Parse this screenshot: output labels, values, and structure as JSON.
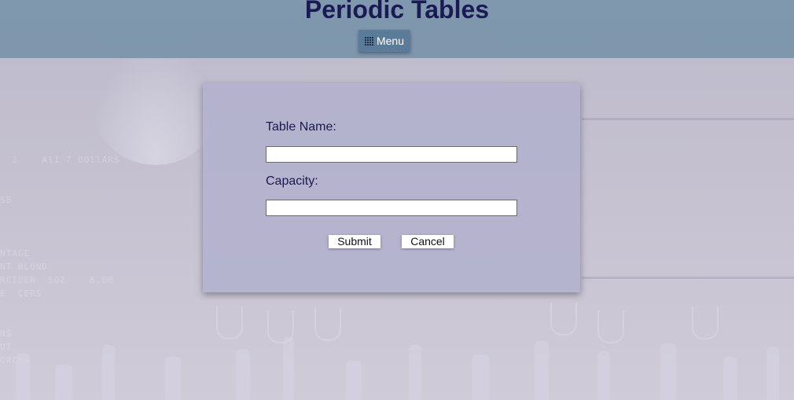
{
  "header": {
    "title": "Periodic Tables",
    "menu_label": "Menu",
    "menu_icon": "grid-icon"
  },
  "form": {
    "table_name_label": "Table Name:",
    "table_name_value": "",
    "capacity_label": "Capacity:",
    "capacity_value": "",
    "submit_label": "Submit",
    "cancel_label": "Cancel"
  },
  "colors": {
    "header_bg": "#7f98ad",
    "title_color": "#1a1a55",
    "menu_button_bg": "#5a7b99",
    "card_bg": "#b2b0cc"
  }
}
